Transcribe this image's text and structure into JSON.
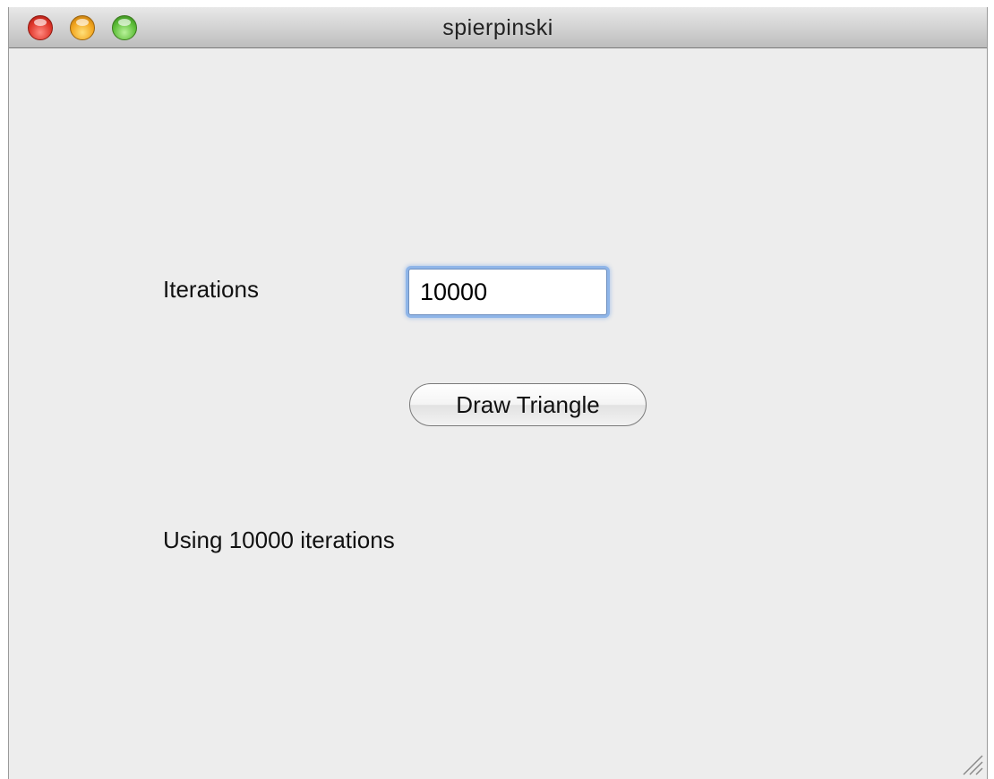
{
  "window": {
    "title": "spierpinski"
  },
  "form": {
    "iterations_label": "Iterations",
    "iterations_value": "10000",
    "draw_button_label": "Draw Triangle",
    "status_text": "Using 10000 iterations"
  }
}
